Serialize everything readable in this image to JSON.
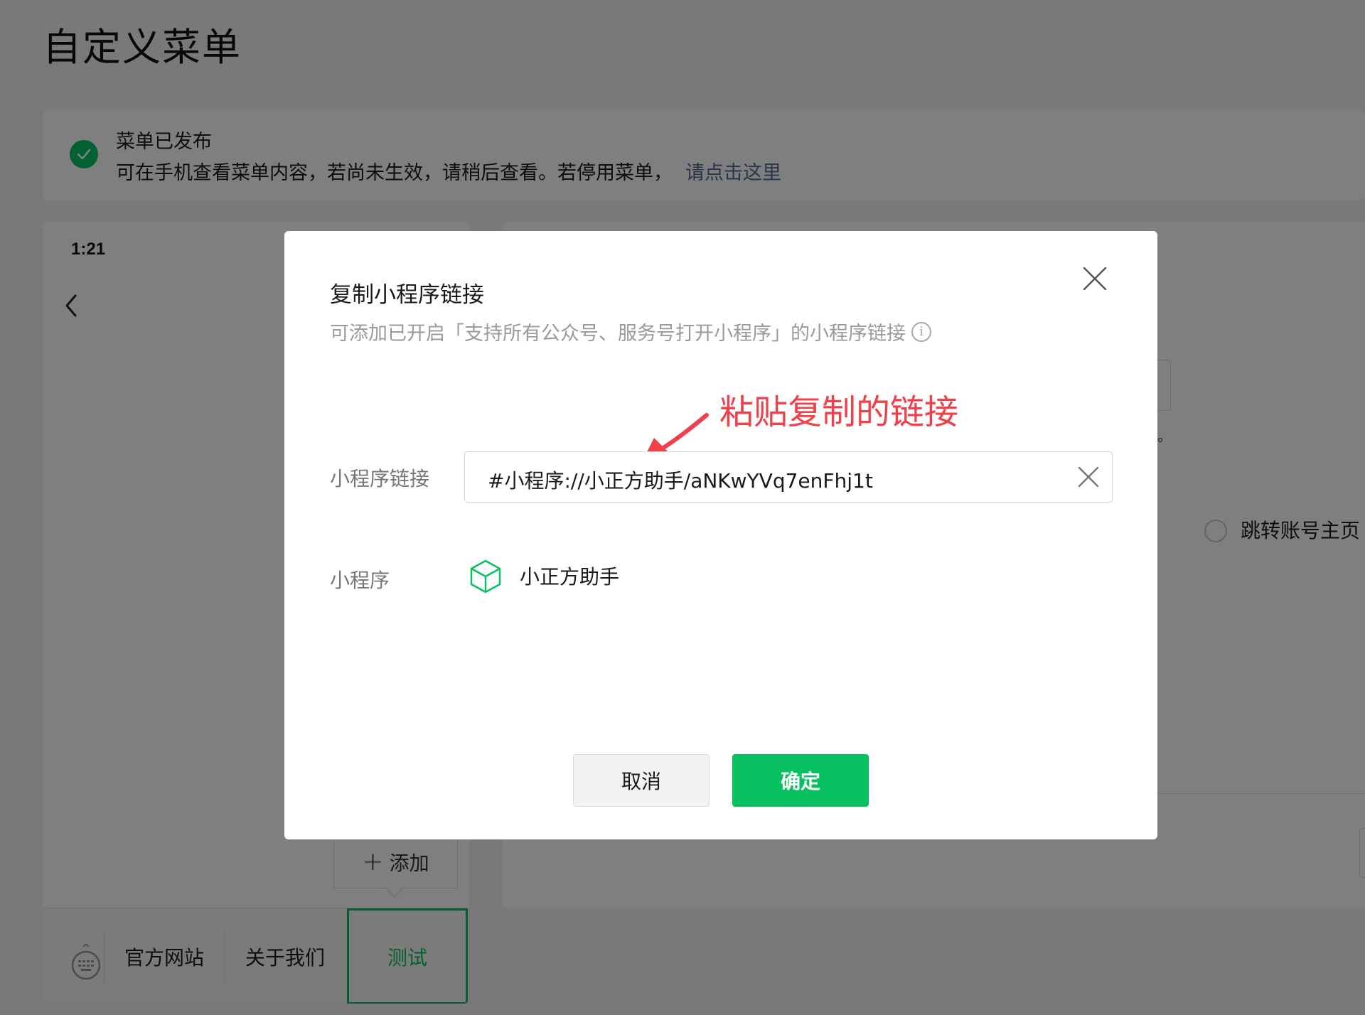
{
  "page": {
    "title": "自定义菜单"
  },
  "notice": {
    "title": "菜单已发布",
    "description": "可在手机查看菜单内容，若尚未生效，请稍后查看。若停用菜单，",
    "link": "请点击这里",
    "icon": "check-circle-icon",
    "status_color": "#07c160"
  },
  "phone": {
    "time": "1:21",
    "add_button": "添加",
    "menu_items": [
      "官方网站",
      "关于我们",
      "测试"
    ],
    "active_item": "测试"
  },
  "right_panel": {
    "radio_label": "跳转账号主页"
  },
  "dialog": {
    "title": "复制小程序链接",
    "subtitle": "可添加已开启「支持所有公众号、服务号打开小程序」的小程序链接",
    "annotation": "粘贴复制的链接",
    "link_label": "小程序链接",
    "link_value": "#小程序://小正方助手/aNKwYVq7enFhj1t",
    "app_label": "小程序",
    "app_name": "小正方助手",
    "cancel_label": "取消",
    "confirm_label": "确定"
  },
  "colors": {
    "accent": "#07c160",
    "link": "#576b95",
    "annotation": "#f0414b"
  }
}
